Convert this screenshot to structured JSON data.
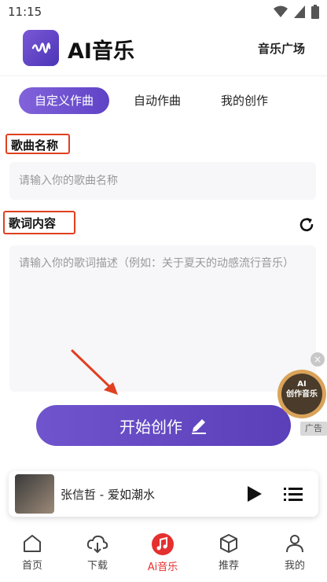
{
  "status_bar": {
    "time": "11:15"
  },
  "header": {
    "title": "AI音乐",
    "square_link": "音乐广场"
  },
  "tabs": [
    {
      "label": "自定义作曲",
      "active": true
    },
    {
      "label": "自动作曲",
      "active": false
    },
    {
      "label": "我的创作",
      "active": false
    }
  ],
  "form": {
    "name_label": "歌曲名称",
    "name_placeholder": "请输入你的歌曲名称",
    "lyric_label": "歌词内容",
    "lyric_placeholder": "请输入你的歌词描述（例如：关于夏天的动感流行音乐）"
  },
  "start_button": {
    "label": "开始创作"
  },
  "ad": {
    "badge_line1": "AI",
    "badge_line2": "创作音乐",
    "tag": "广告",
    "close": "×"
  },
  "player": {
    "song": "张信哲 - 爱如潮水"
  },
  "nav": [
    {
      "label": "首页",
      "icon": "home-icon"
    },
    {
      "label": "下载",
      "icon": "cloud-download-icon"
    },
    {
      "label": "Ai音乐",
      "icon": "music-note-icon",
      "active": true
    },
    {
      "label": "推荐",
      "icon": "box-icon"
    },
    {
      "label": "我的",
      "icon": "person-icon"
    }
  ],
  "colors": {
    "accent": "#6a4fcf",
    "nav_active": "#e53030",
    "highlight_box": "#e04020"
  }
}
